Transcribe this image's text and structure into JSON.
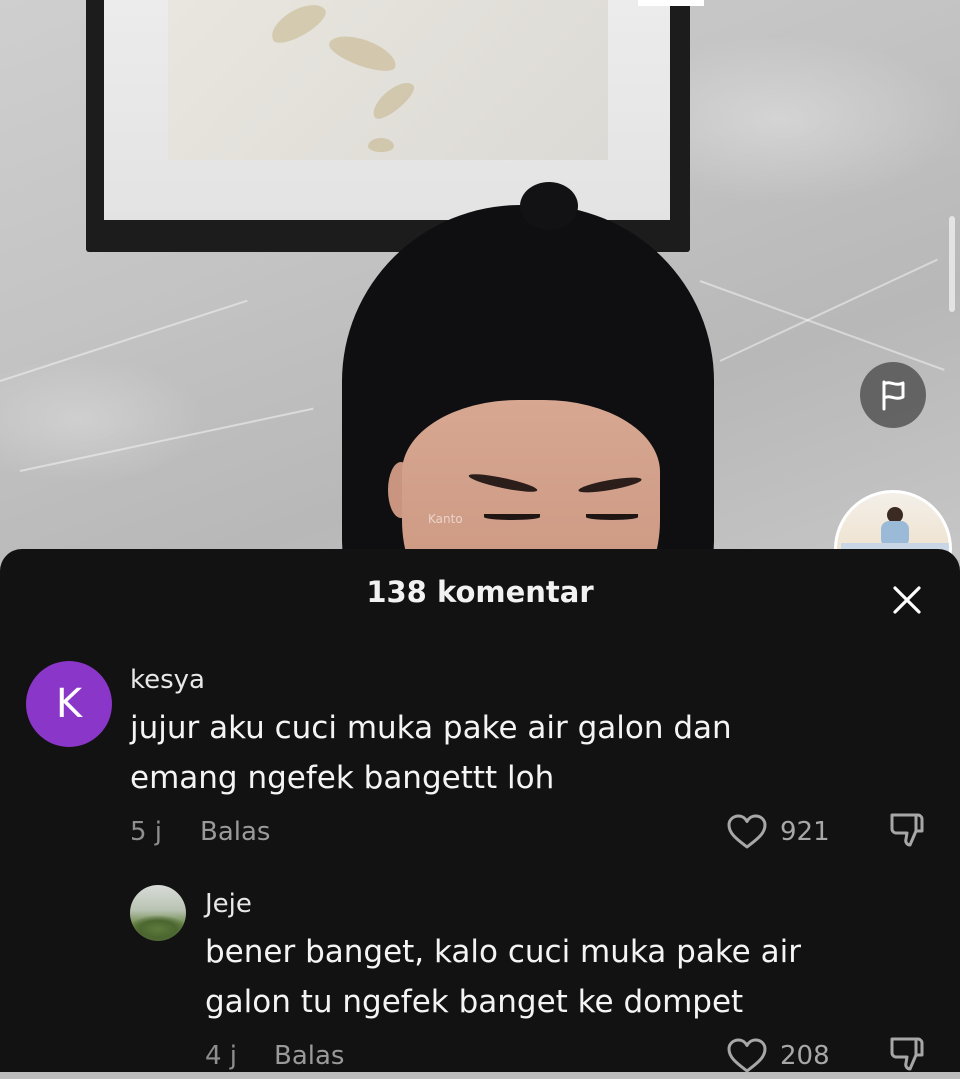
{
  "video": {
    "watermark": "Kanto"
  },
  "sheet": {
    "title": "138 komentar"
  },
  "comments": [
    {
      "avatar_letter": "K",
      "avatar_color": "#8a36c9",
      "username": "kesya",
      "text_line1": "jujur aku cuci muka pake air galon dan",
      "text_line2": "emang ngefek bangettt loh",
      "time": "5 j",
      "reply_label": "Balas",
      "likes": "921"
    },
    {
      "username": "Jeje",
      "text_line1": "bener banget, kalo cuci muka pake air",
      "text_line2": "galon tu ngefek banget ke dompet",
      "time": "4 j",
      "reply_label": "Balas",
      "likes": "208"
    }
  ],
  "icons": {
    "flag": "flag-icon",
    "close": "close-icon",
    "like": "heart-icon",
    "dislike": "thumbs-down-icon"
  },
  "colors": {
    "sheet_bg": "#121212",
    "accent_avatar": "#8a36c9"
  }
}
